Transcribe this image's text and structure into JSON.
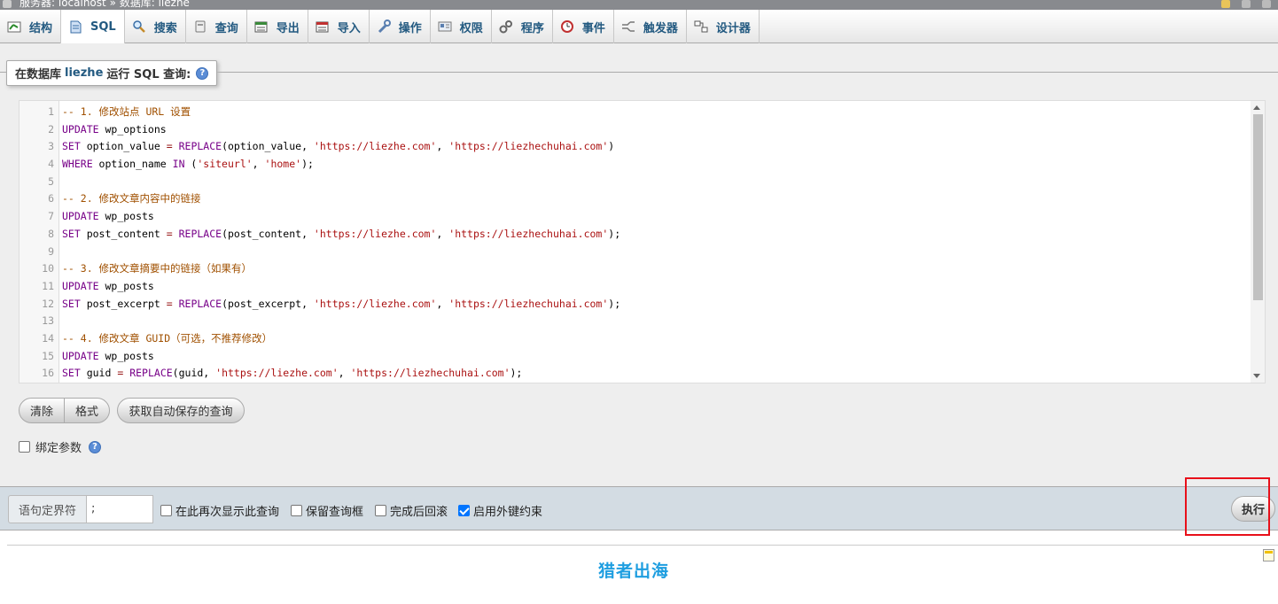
{
  "breadcrumb": {
    "server": "服务器: localhost",
    "separator": "»",
    "database": "数据库: liezhe"
  },
  "tabs": [
    {
      "label": "结构",
      "icon": "structure-icon"
    },
    {
      "label": "SQL",
      "icon": "sql-icon",
      "active": true
    },
    {
      "label": "搜索",
      "icon": "search-icon"
    },
    {
      "label": "查询",
      "icon": "query-icon"
    },
    {
      "label": "导出",
      "icon": "export-icon"
    },
    {
      "label": "导入",
      "icon": "import-icon"
    },
    {
      "label": "操作",
      "icon": "wrench-icon"
    },
    {
      "label": "权限",
      "icon": "privileges-icon"
    },
    {
      "label": "程序",
      "icon": "routines-icon"
    },
    {
      "label": "事件",
      "icon": "events-icon"
    },
    {
      "label": "触发器",
      "icon": "triggers-icon"
    },
    {
      "label": "设计器",
      "icon": "designer-icon"
    }
  ],
  "legend": {
    "prefix": "在数据库",
    "db": "liezhe",
    "suffix": "运行 SQL 查询:",
    "help": "?"
  },
  "editor": {
    "lines": [
      "-- 1. 修改站点 URL 设置",
      "UPDATE wp_options",
      "SET option_value = REPLACE(option_value, 'https://liezhe.com', 'https://liezhechuhai.com')",
      "WHERE option_name IN ('siteurl', 'home');",
      "",
      "-- 2. 修改文章内容中的链接",
      "UPDATE wp_posts",
      "SET post_content = REPLACE(post_content, 'https://liezhe.com', 'https://liezhechuhai.com');",
      "",
      "-- 3. 修改文章摘要中的链接（如果有）",
      "UPDATE wp_posts",
      "SET post_excerpt = REPLACE(post_excerpt, 'https://liezhe.com', 'https://liezhechuhai.com');",
      "",
      "-- 4. 修改文章 GUID（可选，不推荐修改）",
      "UPDATE wp_posts",
      "SET guid = REPLACE(guid, 'https://liezhe.com', 'https://liezhechuhai.com');"
    ]
  },
  "buttons": {
    "clear": "清除",
    "format": "格式",
    "autosave": "获取自动保存的查询",
    "go": "执行"
  },
  "bind_params": {
    "label": "绑定参数",
    "checked": false
  },
  "footer": {
    "delimiter_label": "语句定界符",
    "delimiter_value": ";",
    "options": [
      {
        "label": "在此再次显示此查询",
        "checked": false
      },
      {
        "label": "保留查询框",
        "checked": false
      },
      {
        "label": "完成后回滚",
        "checked": false
      },
      {
        "label": "启用外键约束",
        "checked": true
      }
    ]
  },
  "watermark": "猎者出海",
  "colors": {
    "link": "#235a81",
    "highlight": "#e8101a",
    "watermark": "#1e9ee0"
  }
}
